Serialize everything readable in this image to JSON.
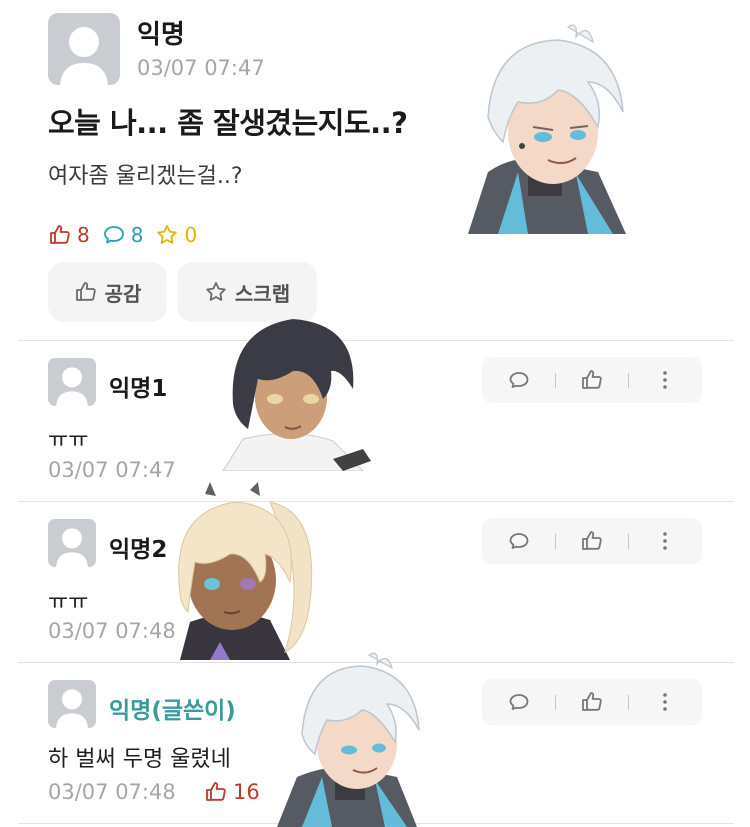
{
  "post": {
    "author": "익명",
    "time": "03/07 07:47",
    "title": "오늘 나... 좀 잘생겼는지도..?",
    "body": "여자좀 울리겠는걸..?",
    "stats": {
      "likes": "8",
      "comments": "8",
      "scraps": "0"
    },
    "actions": {
      "like_label": "공감",
      "scrap_label": "스크랩"
    }
  },
  "comments": [
    {
      "author": "익명1",
      "text": "ㅠㅠ",
      "time": "03/07 07:47",
      "likes": null,
      "is_op": false
    },
    {
      "author": "익명2",
      "text": "ㅠㅠ",
      "time": "03/07 07:48",
      "likes": null,
      "is_op": false
    },
    {
      "author": "익명(글쓴이)",
      "text": "하 벌써 두명 울렸네",
      "time": "03/07 07:48",
      "likes": "16",
      "is_op": true
    }
  ],
  "colors": {
    "like": "#c0392b",
    "comment": "#2b9bb8",
    "scrap": "#e2b400",
    "op_name": "#3a9a9c",
    "muted": "#a6a6a6"
  },
  "icons": {
    "avatar": "default-profile-icon",
    "like": "thumbs-up-icon",
    "comment": "speech-bubble-icon",
    "scrap": "star-icon",
    "more": "vertical-dots-icon"
  }
}
